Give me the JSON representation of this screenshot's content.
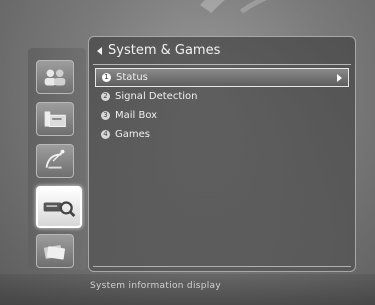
{
  "menu": {
    "title": "System & Games",
    "items": [
      {
        "number": "1",
        "label": "Status"
      },
      {
        "number": "2",
        "label": "Signal Detection"
      },
      {
        "number": "3",
        "label": "Mail Box"
      },
      {
        "number": "4",
        "label": "Games"
      }
    ],
    "selected_index": 0
  },
  "sidebar": {
    "items": [
      {
        "icon": "users-icon"
      },
      {
        "icon": "folder-icon"
      },
      {
        "icon": "satellite-dish-icon"
      },
      {
        "icon": "system-search-icon",
        "active": true
      },
      {
        "icon": "card-stack-icon"
      }
    ]
  },
  "status_bar": {
    "text": "System information display"
  }
}
